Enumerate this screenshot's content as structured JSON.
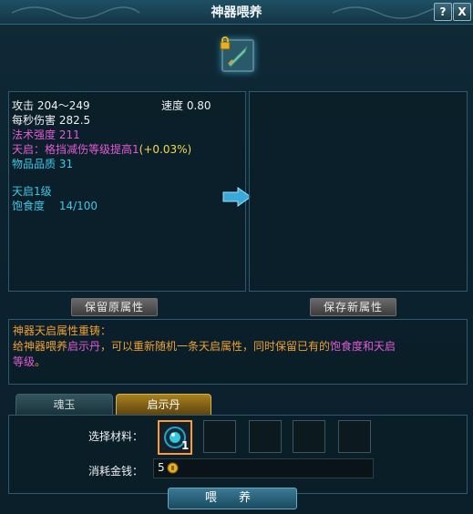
{
  "window": {
    "title": "神器喂养",
    "help_label": "?",
    "close_label": "X"
  },
  "stats_left": {
    "attack": "攻击 204～249",
    "speed": "速度 0.80",
    "dps": "每秒伤害 282.5",
    "spell_power": "法术强度 211",
    "tianqi_label": "天启：格挡减伤等级提高1",
    "tianqi_bonus": "(+0.03%)",
    "quality": "物品品质 31",
    "tianqi_level": "天启1级",
    "satiety": "饱食度　 14/100"
  },
  "buttons": {
    "keep_old": "保留原属性",
    "save_new": "保存新属性",
    "feed": "喂 养"
  },
  "description": {
    "heading": "神器天启属性重铸：",
    "line2_a": "给神器喂养",
    "line2_b": "启示丹",
    "line2_c": "，可以重新随机一条天启属性，同时保留已有的",
    "line2_d": "饱食度和天启",
    "line3": "等级",
    "line3_end": "。"
  },
  "tabs": [
    {
      "label": "魂玉"
    },
    {
      "label": "启示丹"
    }
  ],
  "materials": {
    "label": "选择材料：",
    "slot1_qty": "1"
  },
  "cost": {
    "label": "消耗金钱：",
    "value": "5"
  },
  "colors": {
    "accent_orange": "#f0a030",
    "magenta": "#e35ad6",
    "cyan": "#3fc7e8",
    "yellow": "#f2d94a"
  },
  "icons": [
    "lock-icon",
    "sword-icon",
    "arrow-right-icon",
    "gem-icon",
    "coin-icon"
  ]
}
